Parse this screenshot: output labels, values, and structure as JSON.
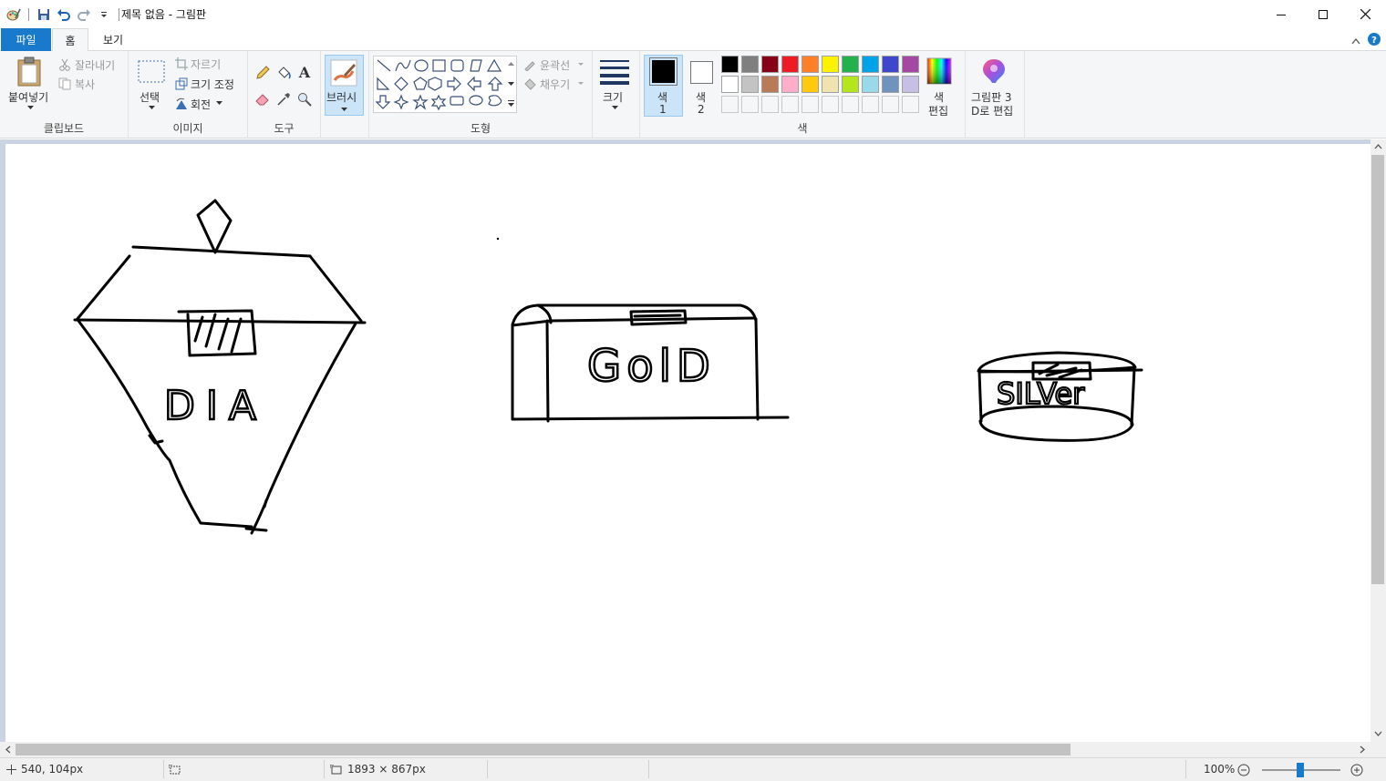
{
  "window": {
    "title": "제목 없음 - 그림판"
  },
  "tabs": {
    "file": "파일",
    "home": "홈",
    "view": "보기"
  },
  "clipboard": {
    "paste": "붙여넣기",
    "cut": "잘라내기",
    "copy": "복사",
    "group": "클립보드"
  },
  "image": {
    "select": "선택",
    "crop": "자르기",
    "resize": "크기 조정",
    "rotate": "회전",
    "group": "이미지"
  },
  "tools": {
    "group": "도구",
    "brush": "브러시"
  },
  "shapes": {
    "outline": "윤곽선",
    "fill": "채우기",
    "group": "도형"
  },
  "size": {
    "label": "크기"
  },
  "colors": {
    "color1_label": "색",
    "color1_num": "1",
    "color2_label": "색",
    "color2_num": "2",
    "edit_line1": "색",
    "edit_line2": "편집",
    "group": "색",
    "palette_row1": [
      "#000000",
      "#7f7f7f",
      "#880015",
      "#ed1c24",
      "#ff7f27",
      "#fff200",
      "#22b14c",
      "#00a2e8",
      "#3f48cc",
      "#a349a4"
    ],
    "palette_row2": [
      "#ffffff",
      "#c3c3c3",
      "#b97a57",
      "#ffaec9",
      "#ffc90e",
      "#efe4b0",
      "#b5e61d",
      "#99d9ea",
      "#7092be",
      "#c8bfe7"
    ],
    "color1_value": "#000000",
    "color2_value": "#ffffff"
  },
  "paint3d": {
    "line1": "그림판 3",
    "line2": "D로 편집"
  },
  "canvas_text": {
    "dia": "DIA",
    "gold": "GolD",
    "silver": "SILVer"
  },
  "status": {
    "cursor": "540, 104px",
    "size": "1893 × 867px",
    "zoom": "100%"
  }
}
